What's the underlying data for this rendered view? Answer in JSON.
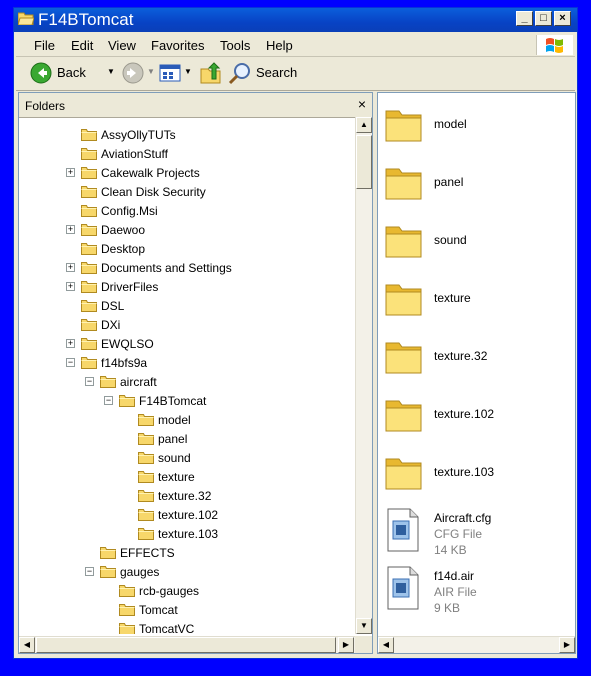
{
  "window": {
    "title": "F14BTomcat",
    "minimize": "_",
    "maximize": "□",
    "close": "×"
  },
  "menu": [
    "File",
    "Edit",
    "View",
    "Favorites",
    "Tools",
    "Help"
  ],
  "toolbar": {
    "back_label": "Back",
    "search_label": "Search"
  },
  "folders": {
    "title": "Folders",
    "close": "×",
    "tree": [
      {
        "label": "AssyOllyTUTs",
        "expander": ""
      },
      {
        "label": "AviationStuff",
        "expander": ""
      },
      {
        "label": "Cakewalk Projects",
        "expander": "+"
      },
      {
        "label": "Clean Disk Security",
        "expander": ""
      },
      {
        "label": "Config.Msi",
        "expander": ""
      },
      {
        "label": "Daewoo",
        "expander": "+"
      },
      {
        "label": "Desktop",
        "expander": ""
      },
      {
        "label": "Documents and Settings",
        "expander": "+"
      },
      {
        "label": "DriverFiles",
        "expander": "+"
      },
      {
        "label": "DSL",
        "expander": ""
      },
      {
        "label": "DXi",
        "expander": ""
      },
      {
        "label": "EWQLSO",
        "expander": "+"
      },
      {
        "label": "f14bfs9a",
        "expander": "−"
      },
      {
        "label": "aircraft",
        "expander": "−"
      },
      {
        "label": "F14BTomcat",
        "expander": "−"
      },
      {
        "label": "model",
        "expander": ""
      },
      {
        "label": "panel",
        "expander": ""
      },
      {
        "label": "sound",
        "expander": ""
      },
      {
        "label": "texture",
        "expander": ""
      },
      {
        "label": "texture.32",
        "expander": ""
      },
      {
        "label": "texture.102",
        "expander": ""
      },
      {
        "label": "texture.103",
        "expander": ""
      },
      {
        "label": "EFFECTS",
        "expander": ""
      },
      {
        "label": "gauges",
        "expander": "−"
      },
      {
        "label": "rcb-gauges",
        "expander": ""
      },
      {
        "label": "Tomcat",
        "expander": ""
      },
      {
        "label": "TomcatVC",
        "expander": ""
      }
    ]
  },
  "files": [
    {
      "name": "model",
      "kind": "folder"
    },
    {
      "name": "panel",
      "kind": "folder"
    },
    {
      "name": "sound",
      "kind": "folder"
    },
    {
      "name": "texture",
      "kind": "folder"
    },
    {
      "name": "texture.32",
      "kind": "folder"
    },
    {
      "name": "texture.102",
      "kind": "folder"
    },
    {
      "name": "texture.103",
      "kind": "folder"
    },
    {
      "name": "Aircraft.cfg",
      "kind": "file",
      "type": "CFG File",
      "size": "14 KB"
    },
    {
      "name": "f14d.air",
      "kind": "file",
      "type": "AIR File",
      "size": "9 KB"
    }
  ],
  "colors": {
    "desktop": "#0000ff",
    "titlebar": "#0a5fdc",
    "folder": "#f7d76a"
  }
}
